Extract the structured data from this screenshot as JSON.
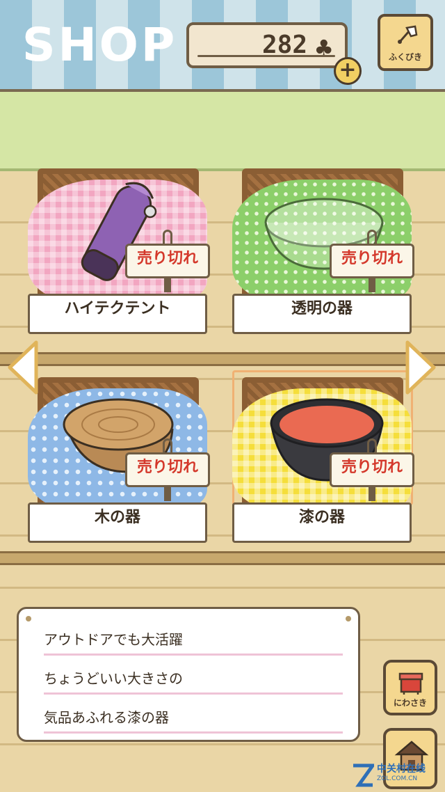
{
  "header": {
    "title": "SHOP",
    "coins": "282",
    "currency_icon": "clover-icon",
    "plus_label": "+",
    "lottery_label": "ふくびき"
  },
  "items": [
    {
      "name": "ハイテクテント",
      "sold_label": "売り切れ",
      "cloth": "pink-gingham",
      "product": "purple-bottle"
    },
    {
      "name": "透明の器",
      "sold_label": "売り切れ",
      "cloth": "green-polka",
      "product": "glass-bowl"
    },
    {
      "name": "木の器",
      "sold_label": "売り切れ",
      "cloth": "blue-polka",
      "product": "wooden-bowl"
    },
    {
      "name": "漆の器",
      "sold_label": "売り切れ",
      "cloth": "yellow-gingham",
      "product": "lacquer-bowl"
    }
  ],
  "description": {
    "lines": [
      "アウトドアでも大活躍",
      "ちょうどいい大きさの",
      "気品あふれる漆の器"
    ]
  },
  "side_buttons": {
    "yard_label": "にわさき"
  },
  "watermark": {
    "text": "中关村在线",
    "sub": "ZOL.COM.CN"
  },
  "colors": {
    "sold_text": "#d4382b",
    "frame_brown": "#6f5d45",
    "button_yellow": "#f4d78f"
  }
}
